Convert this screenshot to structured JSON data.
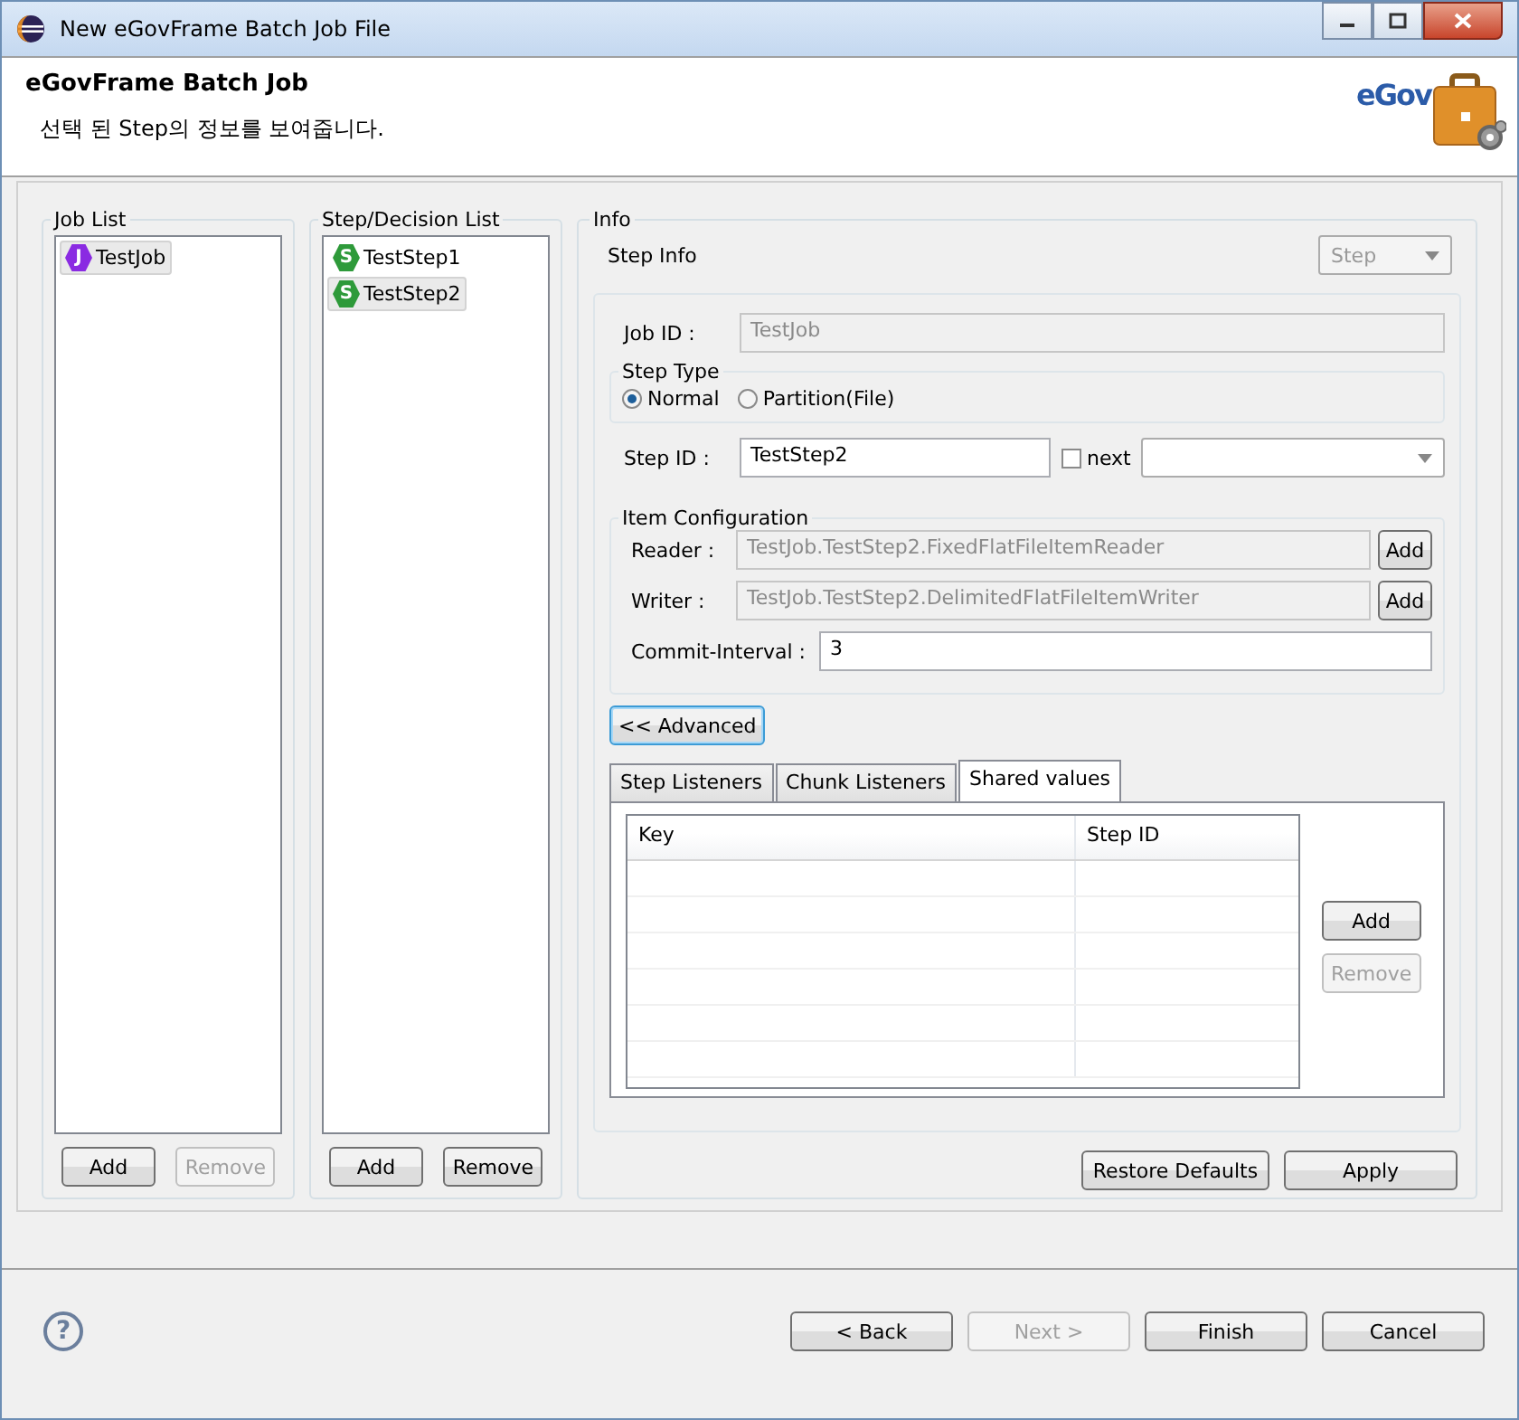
{
  "window": {
    "title": "New eGovFrame Batch Job File"
  },
  "header": {
    "title": "eGovFrame Batch Job",
    "description": "선택 된 Step의 정보를 보여줍니다.",
    "logo_text": "eGov"
  },
  "job_list": {
    "title": "Job List",
    "items": [
      {
        "label": "TestJob",
        "badge": "J",
        "kind": "job",
        "selected": true
      }
    ],
    "buttons": [
      {
        "label": "Add",
        "disabled": false
      },
      {
        "label": "Remove",
        "disabled": true
      }
    ]
  },
  "step_list": {
    "title": "Step/Decision List",
    "items": [
      {
        "label": "TestStep1",
        "badge": "S",
        "kind": "step",
        "selected": false
      },
      {
        "label": "TestStep2",
        "badge": "S",
        "kind": "step",
        "selected": true
      }
    ],
    "buttons": [
      {
        "label": "Add",
        "disabled": false
      },
      {
        "label": "Remove",
        "disabled": false
      }
    ]
  },
  "info": {
    "title": "Info",
    "step_info_label": "Step Info",
    "type_dropdown": {
      "value": "Step",
      "disabled": true
    },
    "job_id": {
      "label": "Job ID :",
      "value": "TestJob",
      "disabled": true
    },
    "step_type": {
      "title": "Step Type",
      "options": [
        {
          "label": "Normal",
          "selected": true
        },
        {
          "label": "Partition(File)",
          "selected": false
        }
      ]
    },
    "step_id": {
      "label": "Step ID :",
      "value": "TestStep2"
    },
    "next": {
      "label": "next",
      "checked": false
    },
    "item_configuration": {
      "title": "Item Configuration",
      "rows": [
        {
          "label": "Reader :",
          "value": "TestJob.TestStep2.FixedFlatFileItemReader",
          "button": "Add"
        },
        {
          "label": "Writer :",
          "value": "TestJob.TestStep2.DelimitedFlatFileItemWriter",
          "button": "Add"
        }
      ],
      "commit_interval": {
        "label": "Commit-Interval :",
        "value": "3"
      }
    },
    "advanced_button": "<< Advanced",
    "tabs": [
      {
        "label": "Step Listeners",
        "selected": false
      },
      {
        "label": "Chunk Listeners",
        "selected": false
      },
      {
        "label": "Shared values",
        "selected": true
      }
    ],
    "table": {
      "columns": [
        "Key",
        "Step ID"
      ]
    },
    "table_buttons": [
      {
        "label": "Add",
        "disabled": false
      },
      {
        "label": "Remove",
        "disabled": true
      }
    ],
    "buttons": [
      "Restore Defaults",
      "Apply"
    ]
  },
  "help": "?",
  "footer_buttons": [
    {
      "label": "< Back",
      "disabled": false
    },
    {
      "label": "Next >",
      "disabled": true
    },
    {
      "label": "Finish",
      "disabled": false
    },
    {
      "label": "Cancel",
      "disabled": false
    }
  ]
}
